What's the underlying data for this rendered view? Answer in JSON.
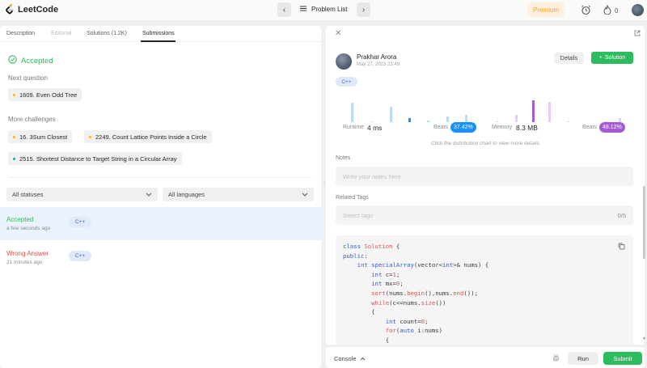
{
  "app": {
    "brand": "LeetCode"
  },
  "topnav": {
    "problem_list": "Problem List",
    "premium": "Premium",
    "streak": "0"
  },
  "left": {
    "tabs": [
      {
        "label": "Description"
      },
      {
        "label": "Editorial"
      },
      {
        "label": "Solutions (1.2K)"
      },
      {
        "label": "Submissions"
      }
    ],
    "status_heading": "Accepted",
    "next_question_label": "Next question",
    "next_question": {
      "label": "1609. Even Odd Tree",
      "dot_color": "#ffb800"
    },
    "more_challenges_label": "More challenges",
    "challenges": [
      {
        "label": "16. 3Sum Closest",
        "dot_color": "#ffb800"
      },
      {
        "label": "2249. Count Lattice Points Inside a Circle",
        "dot_color": "#ffb800"
      },
      {
        "label": "2515. Shortest Distance to Target String in a Circular Array",
        "dot_color": "#00af9b"
      }
    ],
    "filters": {
      "status": "All statuses",
      "language": "All languages"
    },
    "submissions": [
      {
        "status": "Accepted",
        "time": "a few seconds ago",
        "lang": "C++",
        "color": "#2cbb5d"
      },
      {
        "status": "Wrong Answer",
        "time": "21 minutes ago",
        "lang": "C++",
        "color": "#ef4743"
      }
    ]
  },
  "right": {
    "user": {
      "name": "Prakhar Arora",
      "date": "May 27, 2023 23:49"
    },
    "details_label": "Details",
    "solution_label": "Solution",
    "lang": "C++",
    "runtime": {
      "label": "Runtime",
      "value": "4 ms",
      "beats_label": "Beats",
      "beats": "37.42%"
    },
    "memory": {
      "label": "Memory",
      "value": "8.3 MB",
      "beats_label": "Beats",
      "beats": "48.12%"
    },
    "chart_hint": "Click the distribution chart to view more details",
    "notes_label": "Notes",
    "notes_placeholder": "Write your notes here",
    "tags_label": "Related Tags",
    "tags_placeholder": "Select tags",
    "tags_count": "0/5",
    "code": [
      "class Solution {",
      "public:",
      "    int specialArray(vector<int>& nums) {",
      "        int c=1;",
      "        int mx=0;",
      "        sort(nums.begin(),nums.end());",
      "        while(c<=nums.size())",
      "        {",
      "            int count=0;",
      "            for(auto i:nums)",
      "            {"
    ]
  },
  "bottom": {
    "console": "Console",
    "run": "Run",
    "submit": "Submit"
  },
  "colors": {
    "accent_green": "#2cbb5d",
    "runtime_blue": "#1a90ff",
    "memory_purple": "#a55bd6"
  }
}
